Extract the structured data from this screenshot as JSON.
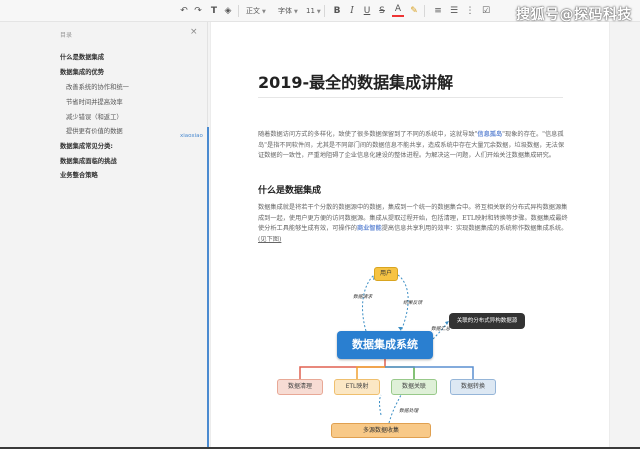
{
  "toolbar": {
    "undo_icon": "undo-icon",
    "redo_icon": "redo-icon",
    "format_painter_icon": "format-painter-icon",
    "clear_format_icon": "eraser-icon",
    "style_select": "正文",
    "font_select": "字体",
    "size_select": "11",
    "bold": "B",
    "italic": "I",
    "underline": "U",
    "strike": "S",
    "font_color": "A",
    "highlight_icon": "highlighter-icon",
    "align_icon": "align-left-icon",
    "list_icon": "bullet-list-icon",
    "check_icon": "checkbox-icon"
  },
  "watermark": "搜狐号@探码科技",
  "sidebar": {
    "title": "目录",
    "close_icon": "close-icon",
    "items": [
      {
        "label": "什么是数据集成",
        "level": 1
      },
      {
        "label": "数据集成的优势",
        "level": 1
      },
      {
        "label": "改善系统的协作和统一",
        "level": 2
      },
      {
        "label": "节省时间并提高效率",
        "level": 2
      },
      {
        "label": "减少错误（和返工）",
        "level": 2
      },
      {
        "label": "提供更有价值的数据",
        "level": 2
      },
      {
        "label": "数据集成常见分类:",
        "level": 1
      },
      {
        "label": "数据集成面临的挑战",
        "level": 1
      },
      {
        "label": "业务整合策略",
        "level": 1
      }
    ],
    "side_label": "xiaoxiao"
  },
  "document": {
    "title": "2019-最全的数据集成讲解",
    "p1_a": "随着数据访问方式的多样化，致使了很多数据保留到了不同的系统中，这就导致\"",
    "p1_link1": "信息孤岛",
    "p1_b": "\"现象的存在。\"信息孤岛\"是指不同软件间，尤其是不同部门间的数据信息不能共享，造成系统中存在大量冗余数据，垃圾数据，无法保证数据的一致性，严重地阻碍了企业信息化建设的整体进程。为解决这一问题，人们开始关注数据集成研究。",
    "h2": "什么是数据集成",
    "p2_a": "数据集成就是将若干个分散的数据源中的数据，集成到一个统一的数据集合中。将互相关联的分布式异构数据源集成到一起，使用户更方便的访问数据源。集成从提取过程开始，包括清理，ETL映射和转换等步骤。数据集成最终使分析工具能够生成有效，可操作的",
    "p2_link": "商业智能",
    "p2_b": "提高信息共享利用的效率：实现数据集成的系统称作数据集成系统。",
    "p2_c": "(见下图)"
  },
  "diagram": {
    "user": "用户",
    "center": "数据集成系统",
    "dark": "关联的分布式异构数据源",
    "boxes": [
      "数据清理",
      "ETL映射",
      "数据关联",
      "数据转换"
    ],
    "bottom": "多源数据收集",
    "lbl_request": "数据请求",
    "lbl_feedback": "结果反馈",
    "lbl_summary": "数据汇总",
    "lbl_process": "数据处理"
  }
}
